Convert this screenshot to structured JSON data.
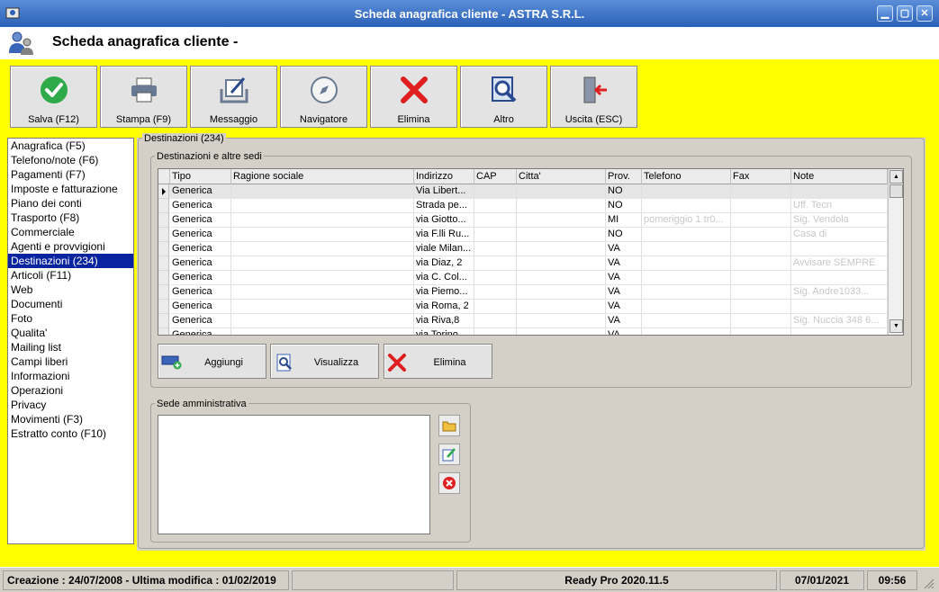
{
  "window": {
    "title": "Scheda anagrafica cliente - ASTRA S.R.L.",
    "controls": [
      "minimize",
      "maximize",
      "close"
    ]
  },
  "header": {
    "title": "Scheda anagrafica cliente -"
  },
  "toolbar": {
    "buttons": [
      {
        "label": "Salva (F12)",
        "icon": "check-circle-icon"
      },
      {
        "label": "Stampa (F9)",
        "icon": "printer-icon"
      },
      {
        "label": "Messaggio",
        "icon": "message-icon"
      },
      {
        "label": "Navigatore",
        "icon": "compass-icon"
      },
      {
        "label": "Elimina",
        "icon": "red-x-icon"
      },
      {
        "label": "Altro",
        "icon": "search-document-icon"
      },
      {
        "label": "Uscita (ESC)",
        "icon": "exit-door-icon"
      }
    ]
  },
  "nav": {
    "items": [
      "Anagrafica (F5)",
      "Telefono/note (F6)",
      "Pagamenti (F7)",
      "Imposte e fatturazione",
      "Piano dei conti",
      "Trasporto (F8)",
      "Commerciale",
      "Agenti e provvigioni",
      "Destinazioni (234)",
      "Articoli (F11)",
      "Web",
      "Documenti",
      "Foto",
      "Qualita'",
      "Mailing list",
      "Campi liberi",
      "Informazioni",
      "Operazioni",
      "Privacy",
      "Movimenti (F3)",
      "Estratto conto (F10)"
    ],
    "selected": "Destinazioni (234)"
  },
  "destinations": {
    "group_title": "Destinazioni (234)",
    "subgroup_title": "Destinazioni e altre sedi",
    "columns": [
      "Tipo",
      "Ragione sociale",
      "Indirizzo",
      "CAP",
      "Citta'",
      "Prov.",
      "Telefono",
      "Fax",
      "Note"
    ],
    "rows": [
      {
        "tipo": "Generica",
        "ragione": "",
        "indirizzo": "Via Libert...",
        "cap": "",
        "citta": "",
        "prov": "NO",
        "telefono": "",
        "fax": "",
        "note": ""
      },
      {
        "tipo": "Generica",
        "ragione": "",
        "indirizzo": "Strada pe...",
        "cap": "",
        "citta": "",
        "prov": "NO",
        "telefono": "",
        "fax": "",
        "note": "Uff. Tecn"
      },
      {
        "tipo": "Generica",
        "ragione": "",
        "indirizzo": "via Giotto...",
        "cap": "",
        "citta": "",
        "prov": "MI",
        "telefono": "pomeriggio 1 tr0...",
        "fax": "",
        "note": "Sig. Vendola"
      },
      {
        "tipo": "Generica",
        "ragione": "",
        "indirizzo": "via F.lli Ru...",
        "cap": "",
        "citta": "",
        "prov": "NO",
        "telefono": "",
        "fax": "",
        "note": "Casa di"
      },
      {
        "tipo": "Generica",
        "ragione": "",
        "indirizzo": "viale Milan...",
        "cap": "",
        "citta": "",
        "prov": "VA",
        "telefono": "",
        "fax": "",
        "note": ""
      },
      {
        "tipo": "Generica",
        "ragione": "",
        "indirizzo": "via Diaz, 2",
        "cap": "",
        "citta": "",
        "prov": "VA",
        "telefono": "",
        "fax": "",
        "note": "Avvisare SEMPRE"
      },
      {
        "tipo": "Generica",
        "ragione": "",
        "indirizzo": "via C. Col...",
        "cap": "",
        "citta": "",
        "prov": "VA",
        "telefono": "",
        "fax": "",
        "note": ""
      },
      {
        "tipo": "Generica",
        "ragione": "",
        "indirizzo": "via Piemo...",
        "cap": "",
        "citta": "",
        "prov": "VA",
        "telefono": "",
        "fax": "",
        "note": "Sig. Andre1033..."
      },
      {
        "tipo": "Generica",
        "ragione": "",
        "indirizzo": "via Roma, 2",
        "cap": "",
        "citta": "",
        "prov": "VA",
        "telefono": "",
        "fax": "",
        "note": ""
      },
      {
        "tipo": "Generica",
        "ragione": "",
        "indirizzo": "via Riva,8",
        "cap": "",
        "citta": "",
        "prov": "VA",
        "telefono": "",
        "fax": "",
        "note": "Sig. Nuccia 348 6..."
      },
      {
        "tipo": "Generica",
        "ragione": "",
        "indirizzo": "via Torino",
        "cap": "",
        "citta": "",
        "prov": "VA",
        "telefono": "",
        "fax": "",
        "note": ""
      }
    ],
    "selected_row": 0,
    "actions": [
      {
        "label": "Aggiungi",
        "icon": "add-card-icon"
      },
      {
        "label": "Visualizza",
        "icon": "view-document-icon"
      },
      {
        "label": "Elimina",
        "icon": "red-x-icon"
      }
    ]
  },
  "sede": {
    "title": "Sede amministrativa",
    "value": "",
    "side_buttons": [
      "folder-icon",
      "edit-icon",
      "delete-icon"
    ]
  },
  "status": {
    "creation": "Creazione : 24/07/2008 - Ultima modifica : 01/02/2019",
    "company": "",
    "version": "Ready Pro 2020.11.5",
    "date": "07/01/2021",
    "time": "09:56"
  },
  "colors": {
    "background_highlight": "#ffff00",
    "selection": "#0a24a0",
    "titlebar": "#2a60b8",
    "delete_red": "#e02020",
    "confirm_green": "#2eaa4a"
  }
}
